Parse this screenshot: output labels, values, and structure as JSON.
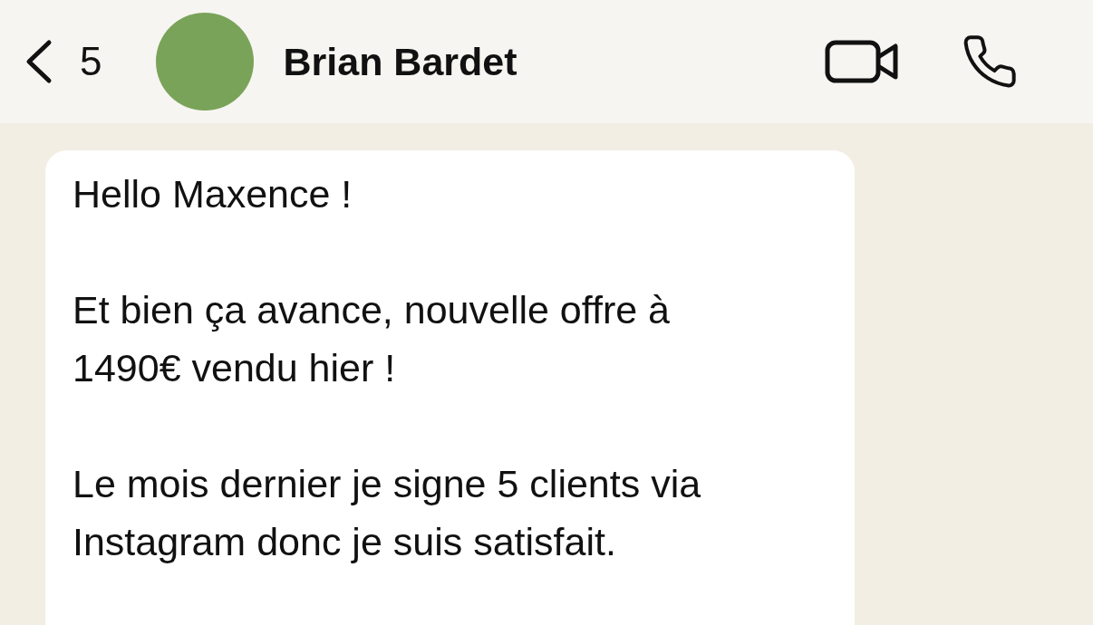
{
  "header": {
    "back_count": "5",
    "contact_name": "Brian Bardet"
  },
  "message": {
    "paragraphs": [
      "Hello Maxence !",
      "Et bien ça avance, nouvelle offre à 1490€ vendu hier !",
      "Le mois dernier je signe 5 clients via Instagram donc je suis satisfait."
    ]
  }
}
